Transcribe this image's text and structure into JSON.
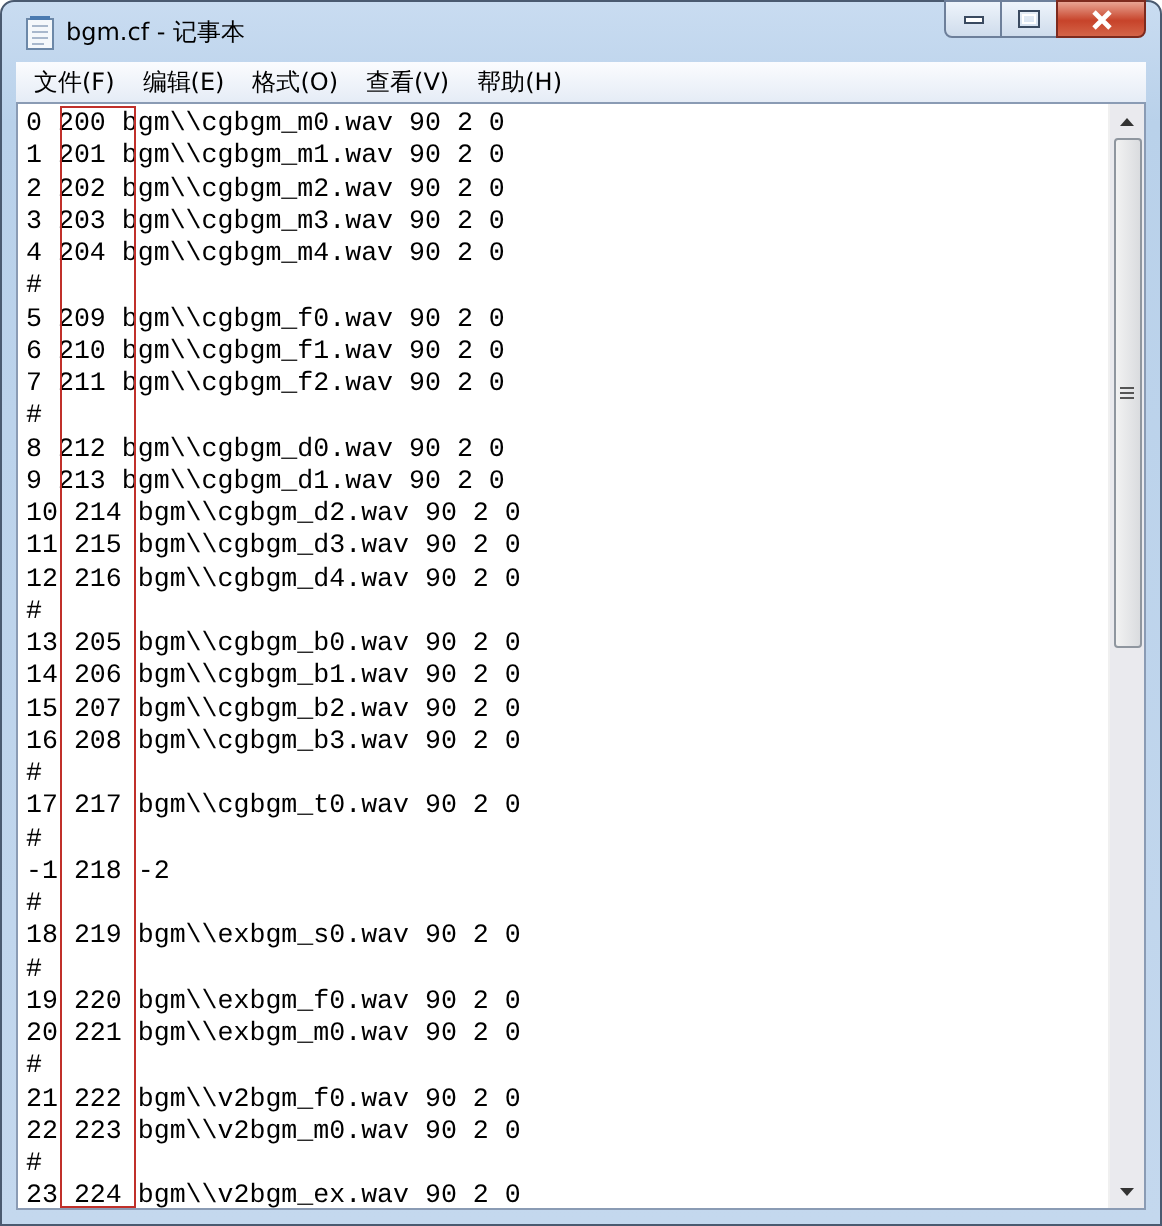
{
  "window": {
    "title": "bgm.cf - 记事本"
  },
  "menu": [
    {
      "label": "文件(F)"
    },
    {
      "label": "编辑(E)"
    },
    {
      "label": "格式(O)"
    },
    {
      "label": "查看(V)"
    },
    {
      "label": "帮助(H)"
    }
  ],
  "lines": [
    {
      "kind": "text",
      "text": "0 200 bgm\\\\cgbgm_m0.wav 90 2 0"
    },
    {
      "kind": "text",
      "text": "1 201 bgm\\\\cgbgm_m1.wav 90 2 0"
    },
    {
      "kind": "text",
      "text": "2 202 bgm\\\\cgbgm_m2.wav 90 2 0"
    },
    {
      "kind": "text",
      "text": "3 203 bgm\\\\cgbgm_m3.wav 90 2 0"
    },
    {
      "kind": "text",
      "text": "4 204 bgm\\\\cgbgm_m4.wav 90 2 0"
    },
    {
      "kind": "text",
      "text": "#"
    },
    {
      "kind": "text",
      "text": "5 209 bgm\\\\cgbgm_f0.wav 90 2 0"
    },
    {
      "kind": "text",
      "text": "6 210 bgm\\\\cgbgm_f1.wav 90 2 0"
    },
    {
      "kind": "text",
      "text": "7 211 bgm\\\\cgbgm_f2.wav 90 2 0"
    },
    {
      "kind": "text",
      "text": "#"
    },
    {
      "kind": "text",
      "text": "8 212 bgm\\\\cgbgm_d0.wav 90 2 0"
    },
    {
      "kind": "text",
      "text": "9 213 bgm\\\\cgbgm_d1.wav 90 2 0"
    },
    {
      "kind": "text",
      "text": "10 214 bgm\\\\cgbgm_d2.wav 90 2 0"
    },
    {
      "kind": "text",
      "text": "11 215 bgm\\\\cgbgm_d3.wav 90 2 0"
    },
    {
      "kind": "text",
      "text": "12 216 bgm\\\\cgbgm_d4.wav 90 2 0"
    },
    {
      "kind": "text",
      "text": "#"
    },
    {
      "kind": "text",
      "text": "13 205 bgm\\\\cgbgm_b0.wav 90 2 0"
    },
    {
      "kind": "text",
      "text": "14 206 bgm\\\\cgbgm_b1.wav 90 2 0"
    },
    {
      "kind": "text",
      "text": "15 207 bgm\\\\cgbgm_b2.wav 90 2 0"
    },
    {
      "kind": "text",
      "text": "16 208 bgm\\\\cgbgm_b3.wav 90 2 0"
    },
    {
      "kind": "text",
      "text": "#"
    },
    {
      "kind": "text",
      "text": "17 217 bgm\\\\cgbgm_t0.wav 90 2 0"
    },
    {
      "kind": "text",
      "text": "#"
    },
    {
      "kind": "text",
      "text": "-1 218 -2"
    },
    {
      "kind": "text",
      "text": "#"
    },
    {
      "kind": "text",
      "text": "18 219 bgm\\\\exbgm_s0.wav 90 2 0"
    },
    {
      "kind": "text",
      "text": "#"
    },
    {
      "kind": "text",
      "text": "19 220 bgm\\\\exbgm_f0.wav 90 2 0"
    },
    {
      "kind": "text",
      "text": "20 221 bgm\\\\exbgm_m0.wav 90 2 0"
    },
    {
      "kind": "text",
      "text": "#"
    },
    {
      "kind": "text",
      "text": "21 222 bgm\\\\v2bgm_f0.wav 90 2 0"
    },
    {
      "kind": "text",
      "text": "22 223 bgm\\\\v2bgm_m0.wav 90 2 0"
    },
    {
      "kind": "text",
      "text": "#"
    },
    {
      "kind": "text",
      "text": "23 224 bgm\\\\v2bgm_ex.wav 90 2 0"
    }
  ]
}
